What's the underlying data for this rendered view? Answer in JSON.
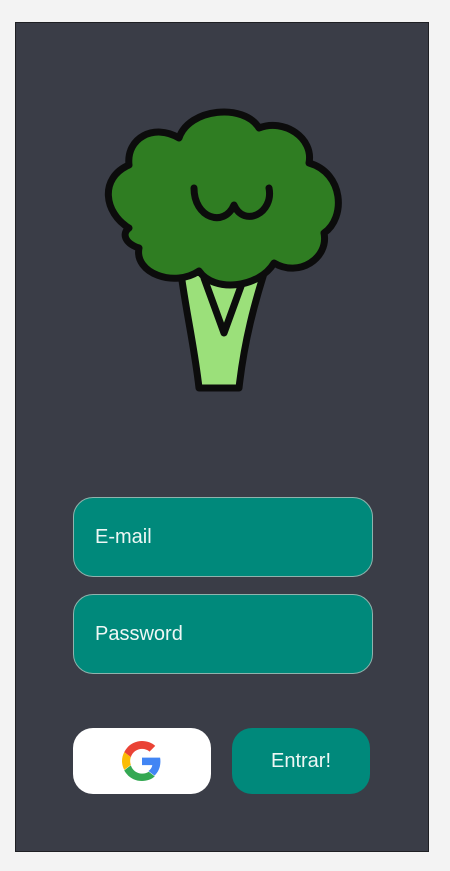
{
  "login": {
    "email_placeholder": "E-mail",
    "password_placeholder": "Password",
    "submit_label": "Entrar!"
  },
  "icons": {
    "logo": "broccoli-icon",
    "google": "google-icon"
  },
  "colors": {
    "background": "#3a3d47",
    "field": "#00897b",
    "button": "#00897b",
    "google_button": "#ffffff",
    "broccoli_dark": "#2f7d22",
    "broccoli_stem": "#9be07a"
  }
}
